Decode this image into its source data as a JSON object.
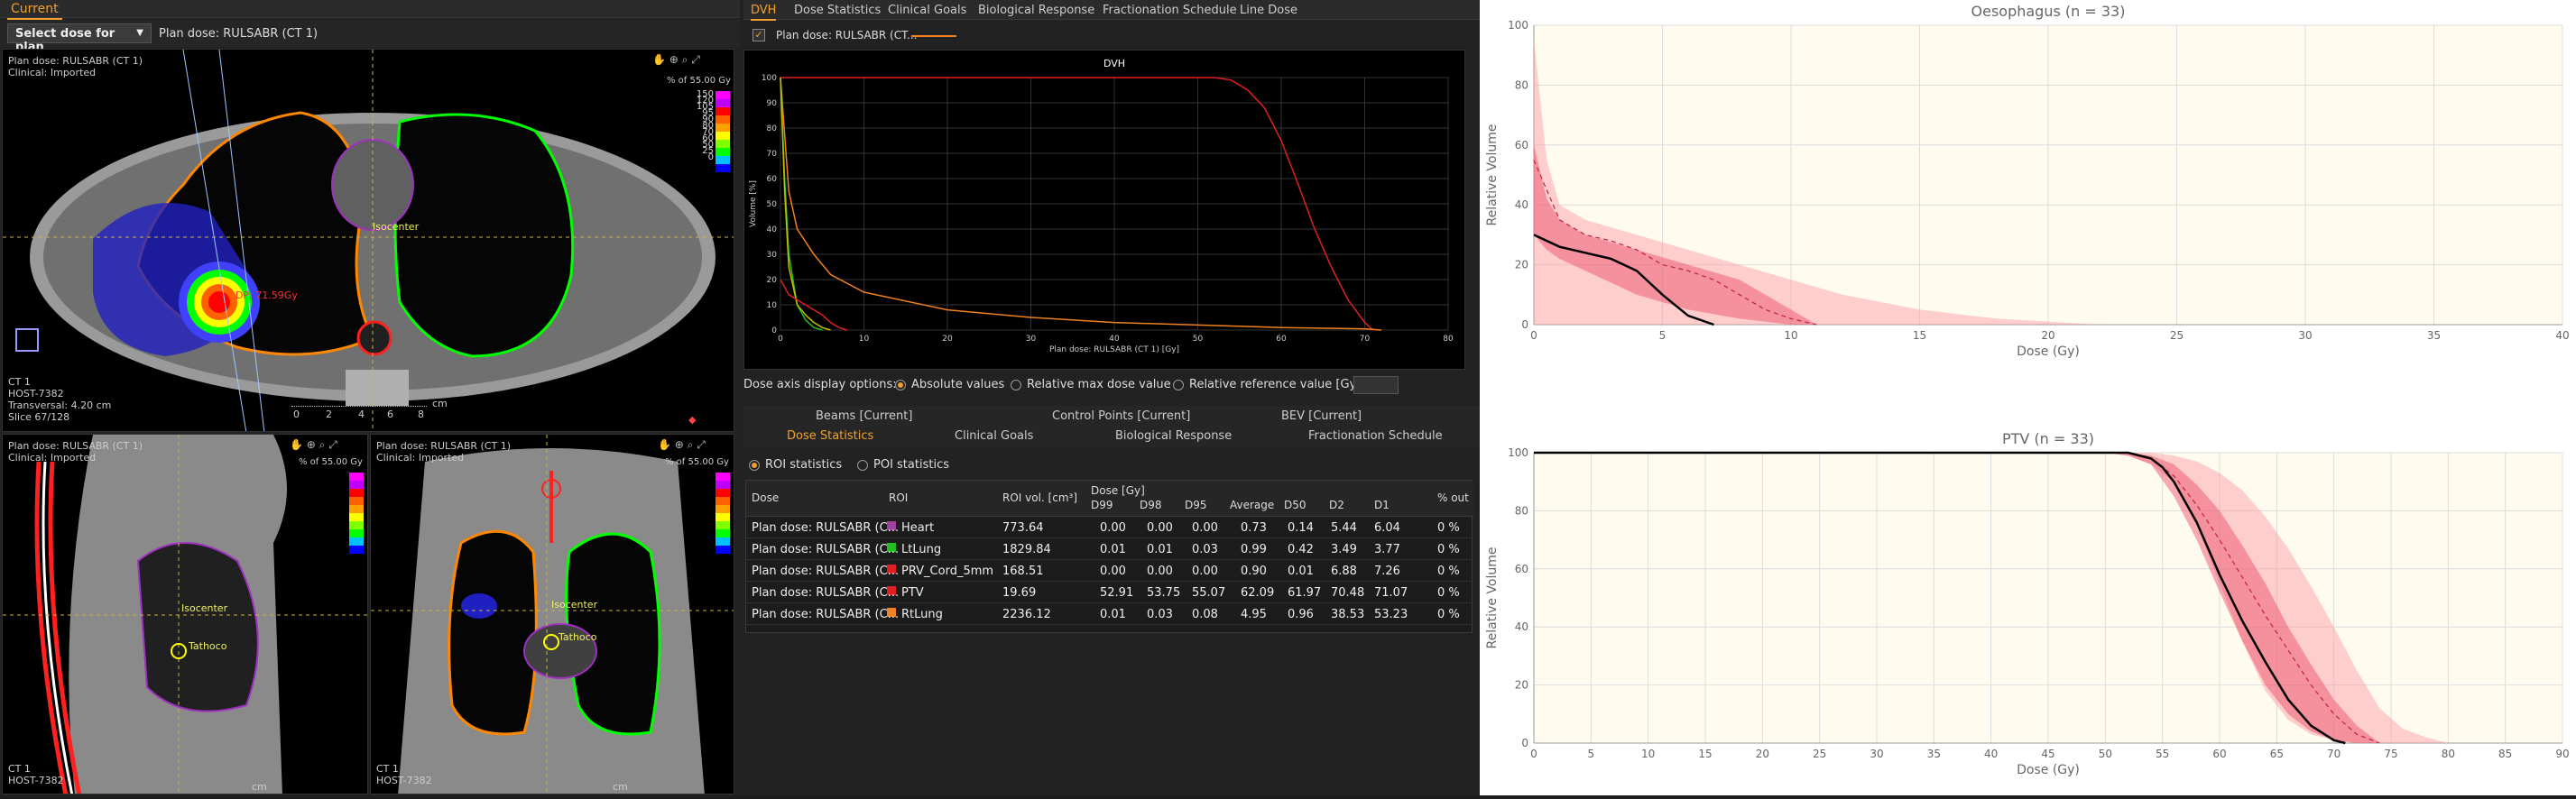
{
  "left": {
    "tab": "Current",
    "select_plan": "Select dose for plan",
    "plan_dose_label": "Plan dose: RULSABR (CT 1)",
    "views": {
      "axial": {
        "title": "Plan dose: RULSABR (CT 1)",
        "clinical": "Clinical: Imported",
        "pct_label": "% of 55.00 Gy",
        "isocenter": "Isocenter",
        "dose_point": "DP: 71.59Gy",
        "ct": "CT 1",
        "host": "HOST-7382",
        "transversal": "Transversal: 4.20 cm",
        "slice": "Slice 67/128",
        "scale_ticks": [
          "0",
          "2",
          "4",
          "6",
          "8"
        ],
        "scale_unit": "cm"
      },
      "sagittal": {
        "title": "Plan dose: RULSABR (CT 1)",
        "clinical": "Clinical: Imported",
        "pct_label": "% of 55.00 Gy",
        "isocenter": "Isocenter",
        "dose_point": "Tathoco",
        "ct": "CT 1",
        "host": "HOST-7382",
        "scale_unit": "cm"
      },
      "coronal": {
        "title": "Plan dose: RULSABR (CT 1)",
        "clinical": "Clinical: Imported",
        "pct_label": "% of 55.00 Gy",
        "isocenter": "Isocenter",
        "dose_point": "Tathoco",
        "ct": "CT 1",
        "host": "HOST-7382",
        "scale_unit": "cm"
      }
    },
    "colorbar_labels": [
      "150",
      "120",
      "105",
      "95",
      "90",
      "80",
      "70",
      "60",
      "50",
      "25",
      "0"
    ],
    "colorbar_colors": [
      "#ff00ff",
      "#c000ff",
      "#ff0000",
      "#ff6000",
      "#ffa000",
      "#ffff00",
      "#80ff00",
      "#00ff00",
      "#00c0ff",
      "#0000ff"
    ]
  },
  "dvh_panel": {
    "tabs": [
      "DVH",
      "Dose Statistics",
      "Clinical Goals",
      "Biological Response",
      "Fractionation Schedule",
      "Line Dose"
    ],
    "active_tab": "DVH",
    "legend_label": "Plan dose: RULSABR (CT...",
    "chart_title": "DVH",
    "y_label": "Volume [%]",
    "x_label": "Plan dose: RULSABR (CT 1) [Gy]",
    "x_ticks": [
      "0",
      "10",
      "20",
      "30",
      "40",
      "50",
      "60",
      "70",
      "80"
    ],
    "y_ticks": [
      "100",
      "90",
      "80",
      "70",
      "60",
      "50",
      "40",
      "30",
      "20",
      "10",
      "0"
    ],
    "axis_options_label": "Dose axis display options:",
    "opt_absolute": "Absolute values",
    "opt_relative_max": "Relative max dose value",
    "opt_relative_ref": "Relative reference value [Gy]:"
  },
  "bottom_panel": {
    "tabs_row1": [
      "Beams [Current]",
      "Control Points [Current]",
      "BEV [Current]"
    ],
    "tabs_row2": [
      "Dose Statistics",
      "Clinical Goals",
      "Biological Response",
      "Fractionation Schedule"
    ],
    "active_tab": "Dose Statistics",
    "roi_stats": "ROI statistics",
    "poi_stats": "POI statistics",
    "headers": {
      "dose": "Dose",
      "roi": "ROI",
      "roi_vol": "ROI vol. [cm³]",
      "dose_gy": "Dose [Gy]",
      "d99": "D99",
      "d98": "D98",
      "d95": "D95",
      "avg": "Average",
      "d50": "D50",
      "d2": "D2",
      "d1": "D1",
      "pct_out": "% out"
    },
    "rows": [
      {
        "dose": "Plan dose: RULSABR (C...",
        "roi": "Heart",
        "color": "#a040a0",
        "vol": "773.64",
        "d99": "0.00",
        "d98": "0.00",
        "d95": "0.00",
        "avg": "0.73",
        "d50": "0.14",
        "d2": "5.44",
        "d1": "6.04",
        "out": "0 %"
      },
      {
        "dose": "Plan dose: RULSABR (C...",
        "roi": "LtLung",
        "color": "#20c020",
        "vol": "1829.84",
        "d99": "0.01",
        "d98": "0.01",
        "d95": "0.03",
        "avg": "0.99",
        "d50": "0.42",
        "d2": "3.49",
        "d1": "3.77",
        "out": "0 %"
      },
      {
        "dose": "Plan dose: RULSABR (C...",
        "roi": "PRV_Cord_5mm",
        "color": "#e02020",
        "vol": "168.51",
        "d99": "0.00",
        "d98": "0.00",
        "d95": "0.00",
        "avg": "0.90",
        "d50": "0.01",
        "d2": "6.88",
        "d1": "7.26",
        "out": "0 %"
      },
      {
        "dose": "Plan dose: RULSABR (C...",
        "roi": "PTV",
        "color": "#e02020",
        "vol": "19.69",
        "d99": "52.91",
        "d98": "53.75",
        "d95": "55.07",
        "avg": "62.09",
        "d50": "61.97",
        "d2": "70.48",
        "d1": "71.07",
        "out": "0 %"
      },
      {
        "dose": "Plan dose: RULSABR (C...",
        "roi": "RtLung",
        "color": "#f08020",
        "vol": "2236.12",
        "d99": "0.01",
        "d98": "0.03",
        "d95": "0.08",
        "avg": "4.95",
        "d50": "0.96",
        "d2": "38.53",
        "d1": "53.23",
        "out": "0 %"
      }
    ]
  },
  "chart_data": [
    {
      "type": "area",
      "title": "Oesophagus (n = 33)",
      "xlabel": "Dose (Gy)",
      "ylabel": "Relative Volume",
      "xlim": [
        0,
        40
      ],
      "ylim": [
        0,
        100
      ],
      "x_ticks": [
        0,
        5,
        10,
        15,
        20,
        25,
        30,
        35,
        40
      ],
      "y_ticks": [
        0,
        20,
        40,
        60,
        80,
        100
      ],
      "outer_band": {
        "x": [
          0,
          0.5,
          1,
          2,
          4,
          6,
          8,
          10,
          12,
          15,
          18,
          20,
          22
        ],
        "upper": [
          95,
          55,
          40,
          35,
          30,
          25,
          20,
          15,
          10,
          5,
          2,
          1,
          0
        ],
        "lower": [
          0,
          0,
          0,
          0,
          0,
          0,
          0,
          0,
          0,
          0,
          0,
          0,
          0
        ]
      },
      "inner_band": {
        "x": [
          0,
          0.5,
          1,
          2,
          4,
          6,
          8,
          10,
          11
        ],
        "upper": [
          60,
          42,
          35,
          30,
          25,
          20,
          15,
          5,
          0
        ],
        "lower": [
          30,
          25,
          22,
          18,
          10,
          5,
          2,
          0,
          0
        ]
      },
      "median": {
        "x": [
          0,
          1,
          2,
          3,
          4,
          5,
          6,
          7,
          8,
          9,
          10,
          11
        ],
        "y": [
          55,
          35,
          30,
          28,
          25,
          20,
          18,
          15,
          10,
          5,
          2,
          0
        ]
      },
      "patient": {
        "x": [
          0,
          1,
          2,
          3,
          4,
          5,
          6,
          7
        ],
        "y": [
          30,
          26,
          24,
          22,
          18,
          10,
          3,
          0
        ]
      }
    },
    {
      "type": "area",
      "title": "PTV (n = 33)",
      "xlabel": "Dose (Gy)",
      "ylabel": "Relative Volume",
      "xlim": [
        0,
        90
      ],
      "ylim": [
        0,
        100
      ],
      "x_ticks": [
        0,
        5,
        10,
        15,
        20,
        25,
        30,
        35,
        40,
        45,
        50,
        55,
        60,
        65,
        70,
        75,
        80,
        85,
        90
      ],
      "y_ticks": [
        0,
        20,
        40,
        60,
        80,
        100
      ],
      "outer_band": {
        "x": [
          50,
          52,
          54,
          56,
          58,
          60,
          62,
          64,
          66,
          68,
          70,
          72,
          74,
          76,
          78,
          80
        ],
        "upper": [
          100,
          100,
          100,
          99,
          97,
          93,
          87,
          78,
          67,
          54,
          40,
          25,
          12,
          5,
          2,
          0
        ],
        "lower": [
          100,
          99,
          96,
          90,
          75,
          55,
          35,
          18,
          8,
          3,
          1,
          0,
          0,
          0,
          0,
          0
        ]
      },
      "inner_band": {
        "x": [
          50,
          52,
          54,
          56,
          58,
          60,
          62,
          64,
          66,
          68,
          70,
          72,
          74
        ],
        "upper": [
          100,
          100,
          99,
          96,
          89,
          80,
          68,
          55,
          40,
          27,
          15,
          6,
          0
        ],
        "lower": [
          100,
          99,
          96,
          85,
          70,
          52,
          35,
          20,
          10,
          4,
          1,
          0,
          0
        ]
      },
      "median": {
        "x": [
          50,
          52,
          54,
          56,
          58,
          60,
          62,
          64,
          66,
          68,
          70,
          72,
          74
        ],
        "y": [
          100,
          100,
          98,
          92,
          82,
          70,
          57,
          44,
          32,
          20,
          10,
          3,
          0
        ]
      },
      "patient": {
        "x": [
          50,
          52,
          54,
          55,
          56,
          58,
          60,
          62,
          64,
          66,
          68,
          70,
          71
        ],
        "y": [
          100,
          100,
          98,
          95,
          90,
          76,
          58,
          42,
          28,
          15,
          6,
          1,
          0
        ]
      }
    },
    {
      "type": "line",
      "title": "DVH",
      "xlabel": "Plan dose: RULSABR (CT 1) [Gy]",
      "ylabel": "Volume [%]",
      "xlim": [
        0,
        80
      ],
      "ylim": [
        0,
        100
      ],
      "series": [
        {
          "name": "PTV",
          "color": "#e02020",
          "x": [
            0,
            52,
            54,
            56,
            58,
            60,
            62,
            64,
            66,
            68,
            70,
            71
          ],
          "y": [
            100,
            100,
            99,
            95,
            88,
            75,
            58,
            40,
            25,
            12,
            3,
            0
          ]
        },
        {
          "name": "RtLung",
          "color": "#f08020",
          "x": [
            0,
            1,
            2,
            4,
            6,
            10,
            20,
            30,
            40,
            50,
            60,
            70,
            72
          ],
          "y": [
            100,
            55,
            40,
            30,
            22,
            15,
            8,
            5,
            3,
            2,
            1,
            0.5,
            0
          ]
        },
        {
          "name": "LtLung",
          "color": "#20c020",
          "x": [
            0,
            0.5,
            1,
            2,
            3,
            4,
            5
          ],
          "y": [
            100,
            60,
            30,
            10,
            4,
            1,
            0
          ]
        },
        {
          "name": "Heart",
          "color": "#c0c000",
          "x": [
            0,
            0.5,
            1,
            2,
            3,
            4,
            5,
            6
          ],
          "y": [
            100,
            55,
            25,
            10,
            6,
            3,
            1,
            0
          ]
        },
        {
          "name": "PRV_Cord_5mm",
          "color": "#e02020",
          "x": [
            0,
            1,
            2,
            3,
            4,
            5,
            6,
            7,
            8
          ],
          "y": [
            20,
            14,
            12,
            10,
            8,
            6,
            3,
            1,
            0
          ]
        }
      ]
    }
  ]
}
